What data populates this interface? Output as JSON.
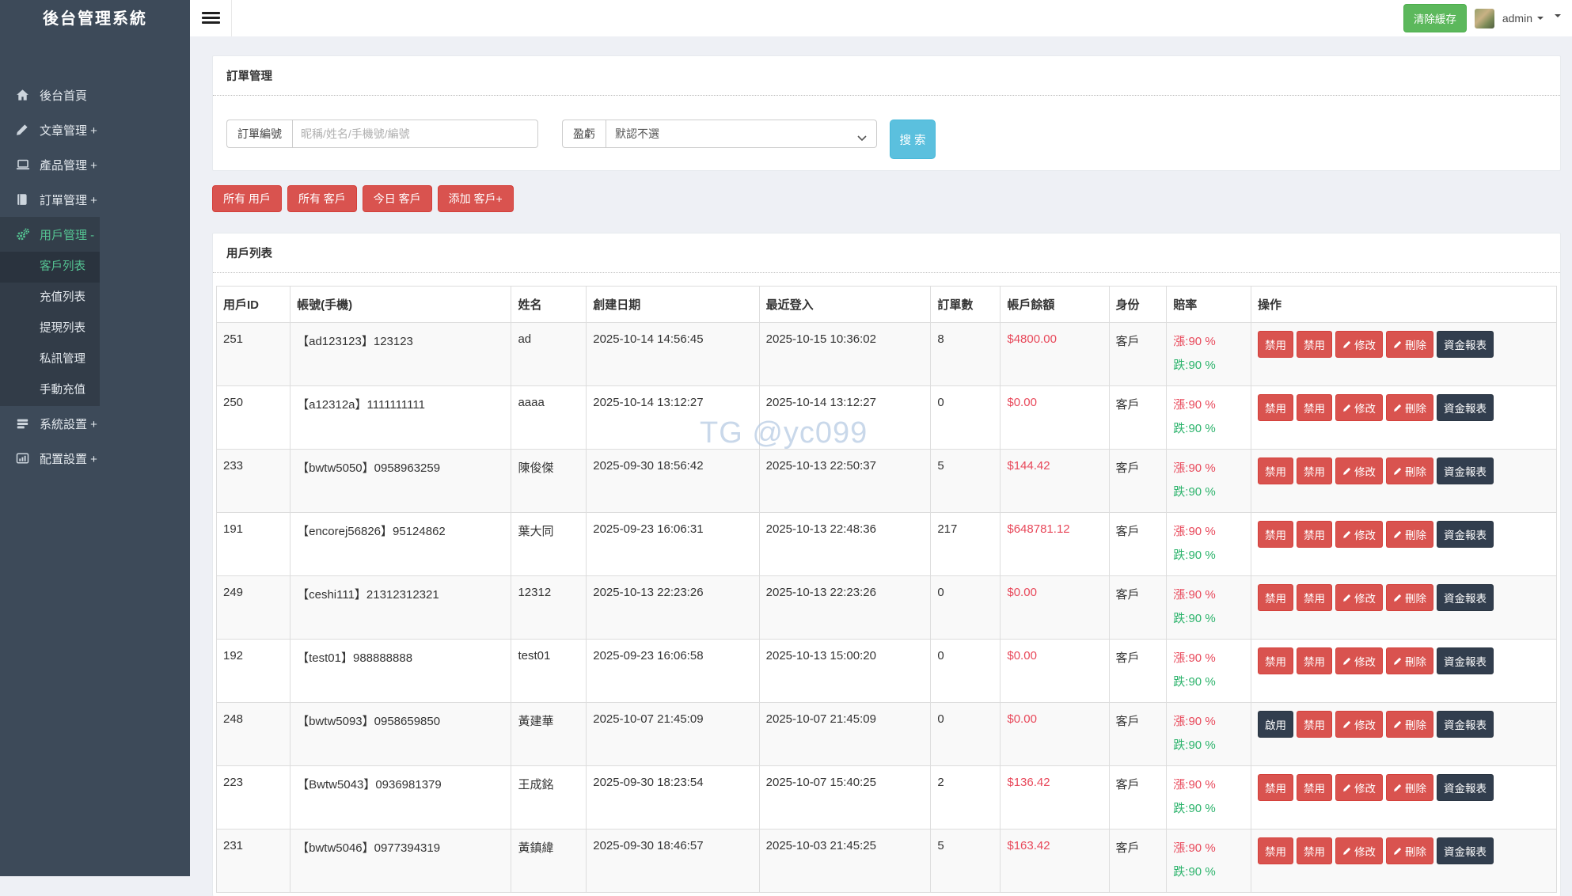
{
  "sidebar": {
    "title": "後台管理系統",
    "items": [
      {
        "label": "後台首頁",
        "icon": "home-icon"
      },
      {
        "label": "文章管理 +",
        "icon": "pencil-icon"
      },
      {
        "label": "產品管理 +",
        "icon": "laptop-icon"
      },
      {
        "label": "訂單管理 +",
        "icon": "book-icon"
      },
      {
        "label": "用戶管理 -",
        "icon": "gears-icon"
      }
    ],
    "submenu": [
      {
        "label": "客戶列表"
      },
      {
        "label": "充值列表"
      },
      {
        "label": "提現列表"
      },
      {
        "label": "私訊管理"
      },
      {
        "label": "手動充值"
      }
    ],
    "bottom_items": [
      {
        "label": "系統設置 +",
        "icon": "list-icon"
      },
      {
        "label": "配置設置 +",
        "icon": "chart-icon"
      }
    ]
  },
  "topbar": {
    "clear_cache_label": "清除緩存",
    "username": "admin"
  },
  "filter": {
    "panel_title": "訂單管理",
    "order_label": "訂單編號",
    "order_placeholder": "昵稱/姓名/手機號/編號",
    "profit_label": "盈虧",
    "profit_selected": "默認不選",
    "search_label": "搜 索"
  },
  "quick_buttons": [
    "所有 用戶",
    "所有 客戶",
    "今日 客戶",
    "添加 客戶+"
  ],
  "table": {
    "panel_title": "用戶列表",
    "columns": [
      "用戶ID",
      "帳號(手機)",
      "姓名",
      "創建日期",
      "最近登入",
      "訂單數",
      "帳戶餘額",
      "身份",
      "賠率",
      "操作"
    ],
    "rows": [
      {
        "id": "251",
        "account": "【ad123123】123123",
        "name": "ad",
        "created": "2025-10-14 14:56:45",
        "last_login": "2025-10-15 10:36:02",
        "orders": "8",
        "balance": "$4800.00",
        "role": "客戶",
        "rise": "漲:90 %",
        "fall": "跌:90 %",
        "actions": [
          {
            "label": "禁用",
            "variant": "red"
          },
          {
            "label": "禁用",
            "variant": "red"
          },
          {
            "label": "修改",
            "variant": "red",
            "pencil": true
          },
          {
            "label": "刪除",
            "variant": "red",
            "pencil": true
          },
          {
            "label": "資金報表",
            "variant": "dark"
          }
        ]
      },
      {
        "id": "250",
        "account": "【a12312a】1111111111",
        "name": "aaaa",
        "created": "2025-10-14 13:12:27",
        "last_login": "2025-10-14 13:12:27",
        "orders": "0",
        "balance": "$0.00",
        "role": "客戶",
        "rise": "漲:90 %",
        "fall": "跌:90 %",
        "actions": [
          {
            "label": "禁用",
            "variant": "red"
          },
          {
            "label": "禁用",
            "variant": "red"
          },
          {
            "label": "修改",
            "variant": "red",
            "pencil": true
          },
          {
            "label": "刪除",
            "variant": "red",
            "pencil": true
          },
          {
            "label": "資金報表",
            "variant": "dark"
          }
        ]
      },
      {
        "id": "233",
        "account": "【bwtw5050】0958963259",
        "name": "陳俊傑",
        "created": "2025-09-30 18:56:42",
        "last_login": "2025-10-13 22:50:37",
        "orders": "5",
        "balance": "$144.42",
        "role": "客戶",
        "rise": "漲:90 %",
        "fall": "跌:90 %",
        "actions": [
          {
            "label": "禁用",
            "variant": "red"
          },
          {
            "label": "禁用",
            "variant": "red"
          },
          {
            "label": "修改",
            "variant": "red",
            "pencil": true
          },
          {
            "label": "刪除",
            "variant": "red",
            "pencil": true
          },
          {
            "label": "資金報表",
            "variant": "dark"
          }
        ]
      },
      {
        "id": "191",
        "account": "【encorej56826】95124862",
        "name": "葉大同",
        "created": "2025-09-23 16:06:31",
        "last_login": "2025-10-13 22:48:36",
        "orders": "217",
        "balance": "$648781.12",
        "role": "客戶",
        "rise": "漲:90 %",
        "fall": "跌:90 %",
        "actions": [
          {
            "label": "禁用",
            "variant": "red"
          },
          {
            "label": "禁用",
            "variant": "red"
          },
          {
            "label": "修改",
            "variant": "red",
            "pencil": true
          },
          {
            "label": "刪除",
            "variant": "red",
            "pencil": true
          },
          {
            "label": "資金報表",
            "variant": "dark"
          }
        ]
      },
      {
        "id": "249",
        "account": "【ceshi111】21312312321",
        "name": "12312",
        "created": "2025-10-13 22:23:26",
        "last_login": "2025-10-13 22:23:26",
        "orders": "0",
        "balance": "$0.00",
        "role": "客戶",
        "rise": "漲:90 %",
        "fall": "跌:90 %",
        "actions": [
          {
            "label": "禁用",
            "variant": "red"
          },
          {
            "label": "禁用",
            "variant": "red"
          },
          {
            "label": "修改",
            "variant": "red",
            "pencil": true
          },
          {
            "label": "刪除",
            "variant": "red",
            "pencil": true
          },
          {
            "label": "資金報表",
            "variant": "dark"
          }
        ]
      },
      {
        "id": "192",
        "account": "【test01】988888888",
        "name": "test01",
        "created": "2025-09-23 16:06:58",
        "last_login": "2025-10-13 15:00:20",
        "orders": "0",
        "balance": "$0.00",
        "role": "客戶",
        "rise": "漲:90 %",
        "fall": "跌:90 %",
        "actions": [
          {
            "label": "禁用",
            "variant": "red"
          },
          {
            "label": "禁用",
            "variant": "red"
          },
          {
            "label": "修改",
            "variant": "red",
            "pencil": true
          },
          {
            "label": "刪除",
            "variant": "red",
            "pencil": true
          },
          {
            "label": "資金報表",
            "variant": "dark"
          }
        ]
      },
      {
        "id": "248",
        "account": "【bwtw5093】0958659850",
        "name": "黃建華",
        "created": "2025-10-07 21:45:09",
        "last_login": "2025-10-07 21:45:09",
        "orders": "0",
        "balance": "$0.00",
        "role": "客戶",
        "rise": "漲:90 %",
        "fall": "跌:90 %",
        "actions": [
          {
            "label": "啟用",
            "variant": "dark"
          },
          {
            "label": "禁用",
            "variant": "red"
          },
          {
            "label": "修改",
            "variant": "red",
            "pencil": true
          },
          {
            "label": "刪除",
            "variant": "red",
            "pencil": true
          },
          {
            "label": "資金報表",
            "variant": "dark"
          }
        ]
      },
      {
        "id": "223",
        "account": "【Bwtw5043】0936981379",
        "name": "王成銘",
        "created": "2025-09-30 18:23:54",
        "last_login": "2025-10-07 15:40:25",
        "orders": "2",
        "balance": "$136.42",
        "role": "客戶",
        "rise": "漲:90 %",
        "fall": "跌:90 %",
        "actions": [
          {
            "label": "禁用",
            "variant": "red"
          },
          {
            "label": "禁用",
            "variant": "red"
          },
          {
            "label": "修改",
            "variant": "red",
            "pencil": true
          },
          {
            "label": "刪除",
            "variant": "red",
            "pencil": true
          },
          {
            "label": "資金報表",
            "variant": "dark"
          }
        ]
      },
      {
        "id": "231",
        "account": "【bwtw5046】0977394319",
        "name": "黃鎮緯",
        "created": "2025-09-30 18:46:57",
        "last_login": "2025-10-03 21:45:25",
        "orders": "5",
        "balance": "$163.42",
        "role": "客戶",
        "rise": "漲:90 %",
        "fall": "跌:90 %",
        "actions": [
          {
            "label": "禁用",
            "variant": "red"
          },
          {
            "label": "禁用",
            "variant": "red"
          },
          {
            "label": "修改",
            "variant": "red",
            "pencil": true
          },
          {
            "label": "刪除",
            "variant": "red",
            "pencil": true
          },
          {
            "label": "資金報表",
            "variant": "dark"
          }
        ]
      }
    ]
  },
  "watermark": "TG @yc099",
  "colors": {
    "sidebar_bg": "#3d4a59",
    "sidebar_active_green": "#55c493",
    "success_green": "#5cb85c",
    "danger_red": "#d9534f",
    "info_blue": "#5bc0de",
    "dark_button": "#323e4e",
    "balance_red": "#e8485a",
    "fall_green": "#2bb36b"
  }
}
